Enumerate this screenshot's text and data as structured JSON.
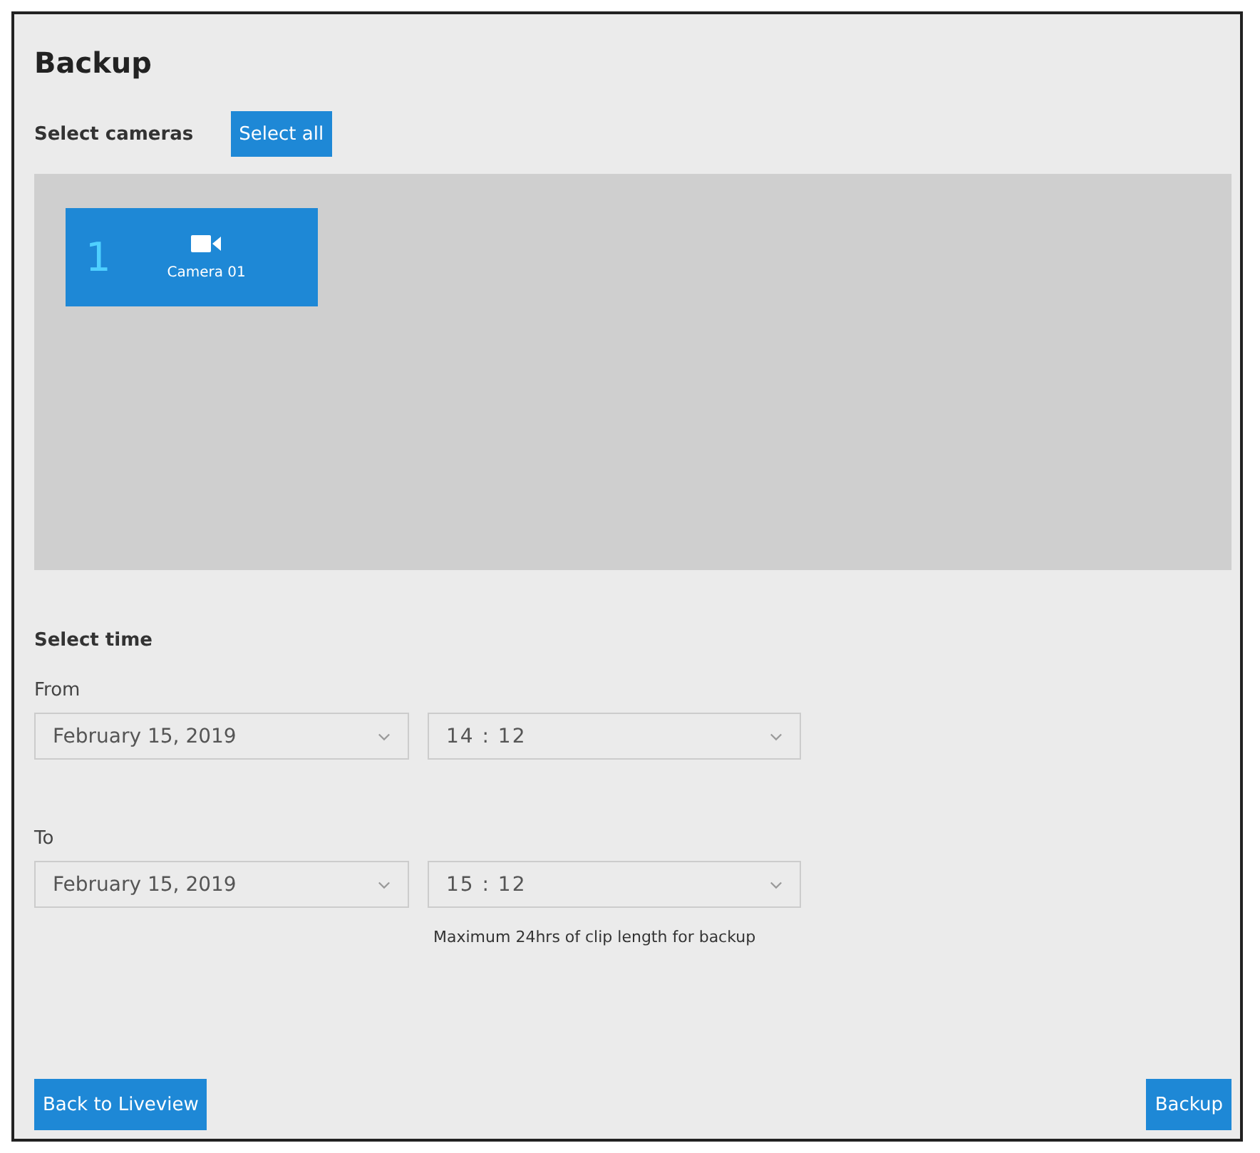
{
  "window": {
    "title": "Backup"
  },
  "cameras_section": {
    "label": "Select cameras",
    "select_all": "Select all"
  },
  "cameras": [
    {
      "number": "1",
      "name": "Camera 01",
      "selected": true
    }
  ],
  "time_section": {
    "label": "Select time",
    "ranges": [
      {
        "label": "From",
        "date": "February 15, 2019",
        "time": "14 : 12"
      },
      {
        "label": "To",
        "date": "February 15, 2019",
        "time": "15 : 12"
      }
    ],
    "note": "Maximum 24hrs of clip length for backup"
  },
  "buttons": [
    {
      "kind": "back",
      "label": "Back to Liveview"
    },
    {
      "kind": "backup",
      "label": "Backup"
    }
  ]
}
